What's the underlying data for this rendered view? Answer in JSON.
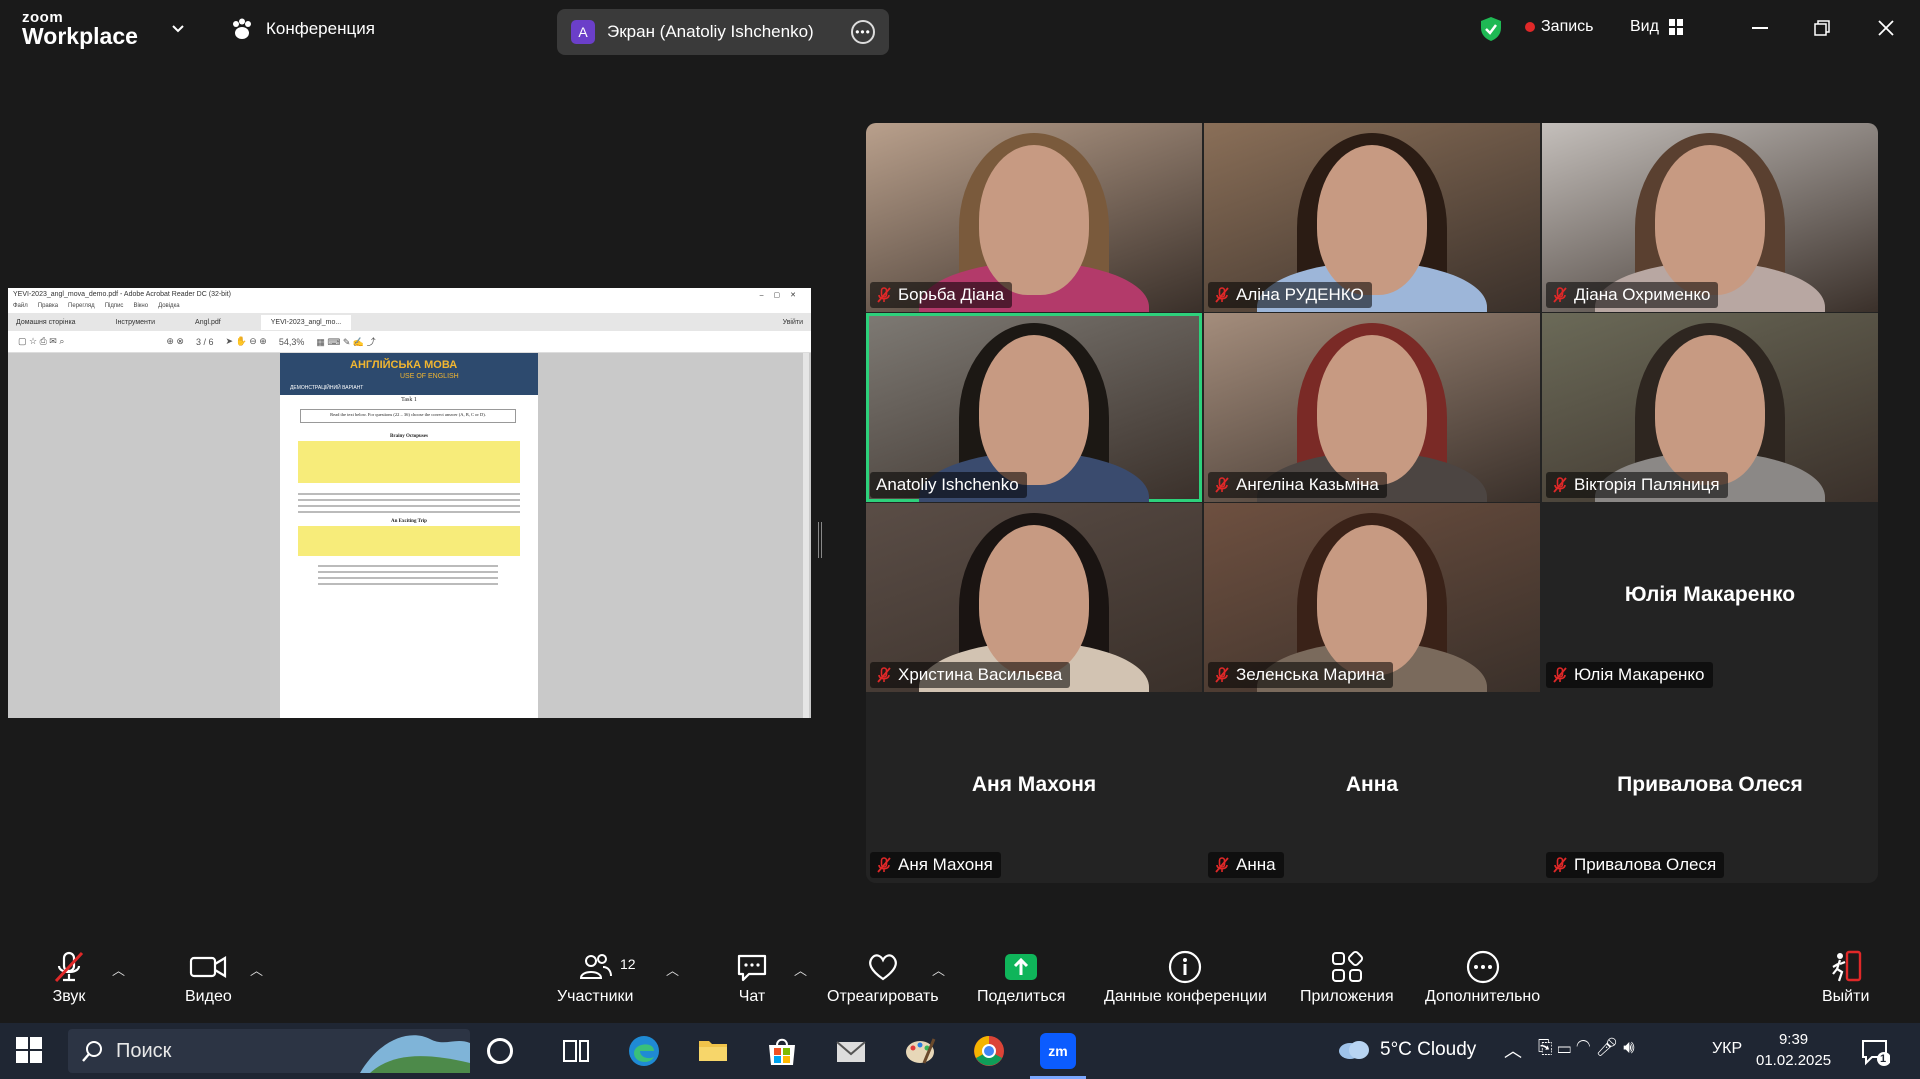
{
  "app": {
    "logo_line1": "zoom",
    "logo_line2": "Workplace",
    "meeting_label": "Конференция"
  },
  "share_pill": {
    "avatar_letter": "A",
    "label": "Экран (Anatoliy Ishchenko)"
  },
  "header_right": {
    "record_label": "Запись",
    "view_label": "Вид"
  },
  "shared_screen": {
    "window_title": "YEVI-2023_angl_mova_demo.pdf - Adobe Acrobat Reader DC (32-bit)",
    "menu": [
      "Файл",
      "Правка",
      "Перегляд",
      "Підпис",
      "Вікно",
      "Довідка"
    ],
    "tabs": [
      "Домашня сторінка",
      "Інструменти",
      "Angl.pdf",
      "YEVI-2023_angl_mo..."
    ],
    "sign_in": "Увійти",
    "page_indicator": "3 / 6",
    "zoom_level": "54,3%",
    "pdf": {
      "title": "АНГЛІЙСЬКА МОВА",
      "subtitle": "USE OF ENGLISH",
      "tag": "ДЕМОНСТРАЦІЙНИЙ ВАРІАНТ",
      "task": "Task 1",
      "instruction": "Read the text below. For questions (22 – 36) choose the correct answer (A, B, C or D).",
      "section1": "Brainy Octopuses",
      "section2": "An Exciting Trip"
    }
  },
  "participants": [
    {
      "name": "Борьба Діана",
      "muted": true,
      "video": true,
      "bg": "#b9a08c",
      "hair": "#7a5a3c",
      "clothes": "#b33a6a"
    },
    {
      "name": "Аліна РУДЕНКО",
      "muted": true,
      "video": true,
      "bg": "#8a6f58",
      "hair": "#2b1c14",
      "clothes": "#9db6d9"
    },
    {
      "name": "Діана Охрименко",
      "muted": true,
      "video": true,
      "bg": "#c4bfbb",
      "hair": "#5a4030",
      "clothes": "#b8a7a2"
    },
    {
      "name": "Anatoliy Ishchenko",
      "muted": false,
      "video": true,
      "active": true,
      "bg": "#7e7a74",
      "hair": "#1c1814",
      "clothes": "#3a4b6e"
    },
    {
      "name": "Ангеліна Казьміна",
      "muted": true,
      "video": true,
      "bg": "#a48d7c",
      "hair": "#7a2a26",
      "clothes": "#4c4542"
    },
    {
      "name": "Вікторія Паляниця",
      "muted": true,
      "video": true,
      "bg": "#6b6a58",
      "hair": "#2e2620",
      "clothes": "#8b8886"
    },
    {
      "name": "Христина Васильєва",
      "muted": true,
      "video": true,
      "bg": "#5a4d46",
      "hair": "#1a1412",
      "clothes": "#d2c3b2"
    },
    {
      "name": "Зеленська Марина",
      "muted": true,
      "video": true,
      "bg": "#6e5040",
      "hair": "#3a2218",
      "clothes": "#7a6a5c"
    },
    {
      "name": "Юлія Макаренко",
      "muted": true,
      "video": false
    },
    {
      "name": "Аня Махоня",
      "muted": true,
      "video": false
    },
    {
      "name": "Анна",
      "muted": true,
      "video": false
    },
    {
      "name": "Привалова Олеся",
      "muted": true,
      "video": false
    }
  ],
  "toolbar": {
    "audio": "Звук",
    "video": "Видео",
    "participants": "Участники",
    "participants_count": "12",
    "chat": "Чат",
    "react": "Отреагировать",
    "share": "Поделиться",
    "info": "Данные конференции",
    "apps": "Приложения",
    "more": "Дополнительно",
    "leave": "Выйти"
  },
  "taskbar": {
    "search_placeholder": "Поиск",
    "weather": "5°C Cloudy",
    "lang": "УКР",
    "time": "9:39",
    "date": "01.02.2025",
    "notif_count": "1"
  },
  "colors": {
    "share_green": "#0fb55a",
    "active_border": "#2dd17b",
    "muted_red": "#e02828",
    "zoom_blue": "#0b5cff"
  }
}
